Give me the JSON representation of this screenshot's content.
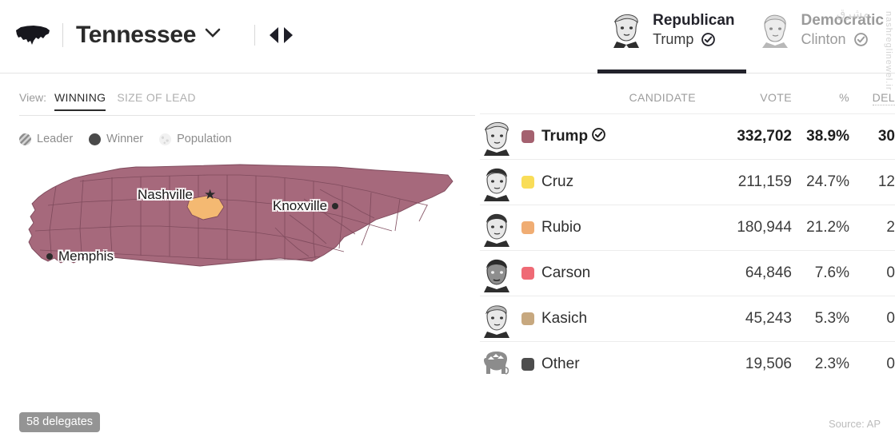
{
  "header": {
    "us_map_icon": "us-map-icon",
    "state_name": "Tennessee",
    "dropdown_icon": "chevron-down-icon",
    "prev_label": "◀",
    "next_label": "▶",
    "party_tabs": [
      {
        "party": "Republican",
        "candidate": "Trump",
        "winner_check": true,
        "active": true,
        "portrait": "trump-portrait"
      },
      {
        "party": "Democratic",
        "candidate": "Clinton",
        "winner_check": true,
        "active": false,
        "portrait": "clinton-portrait"
      }
    ]
  },
  "map_panel": {
    "view_label": "View:",
    "view_options": [
      {
        "label": "WINNING",
        "active": true
      },
      {
        "label": "SIZE OF LEAD",
        "active": false
      }
    ],
    "legend": [
      {
        "label": "Leader",
        "style": "striped"
      },
      {
        "label": "Winner",
        "style": "solid-dark"
      },
      {
        "label": "Population",
        "style": "dotted-light"
      }
    ],
    "cities": [
      {
        "name": "Nashville",
        "marker": "star"
      },
      {
        "name": "Knoxville",
        "marker": "dot"
      },
      {
        "name": "Memphis",
        "marker": "dot"
      }
    ],
    "delegate_badge": "58 delegates",
    "map_fill_color": "#a6697c",
    "map_border_color": "#7e4a5c",
    "highlight_county_color": "#f4b972"
  },
  "results": {
    "columns": {
      "candidate": "CANDIDATE",
      "vote": "VOTE",
      "percent": "%",
      "delegates": "DEL"
    },
    "rows": [
      {
        "name": "Trump",
        "color": "#a4616f",
        "vote": "332,702",
        "percent": "38.9%",
        "delegates": "30",
        "winner": true,
        "portrait": "trump-portrait"
      },
      {
        "name": "Cruz",
        "color": "#f9dd58",
        "vote": "211,159",
        "percent": "24.7%",
        "delegates": "12",
        "winner": false,
        "portrait": "cruz-portrait"
      },
      {
        "name": "Rubio",
        "color": "#f0ad73",
        "vote": "180,944",
        "percent": "21.2%",
        "delegates": "2",
        "winner": false,
        "portrait": "rubio-portrait"
      },
      {
        "name": "Carson",
        "color": "#ef6a75",
        "vote": "64,846",
        "percent": "7.6%",
        "delegates": "0",
        "winner": false,
        "portrait": "carson-portrait"
      },
      {
        "name": "Kasich",
        "color": "#c7a87f",
        "vote": "45,243",
        "percent": "5.3%",
        "delegates": "0",
        "winner": false,
        "portrait": "kasich-portrait"
      },
      {
        "name": "Other",
        "color": "#4d4d4d",
        "vote": "19,506",
        "percent": "2.3%",
        "delegates": "0",
        "winner": false,
        "portrait": "gop-elephant-icon"
      }
    ],
    "source": "Source: AP"
  },
  "watermark": {
    "script_text": "مشرق",
    "vertical_text": "nashreglinewel.ir"
  }
}
